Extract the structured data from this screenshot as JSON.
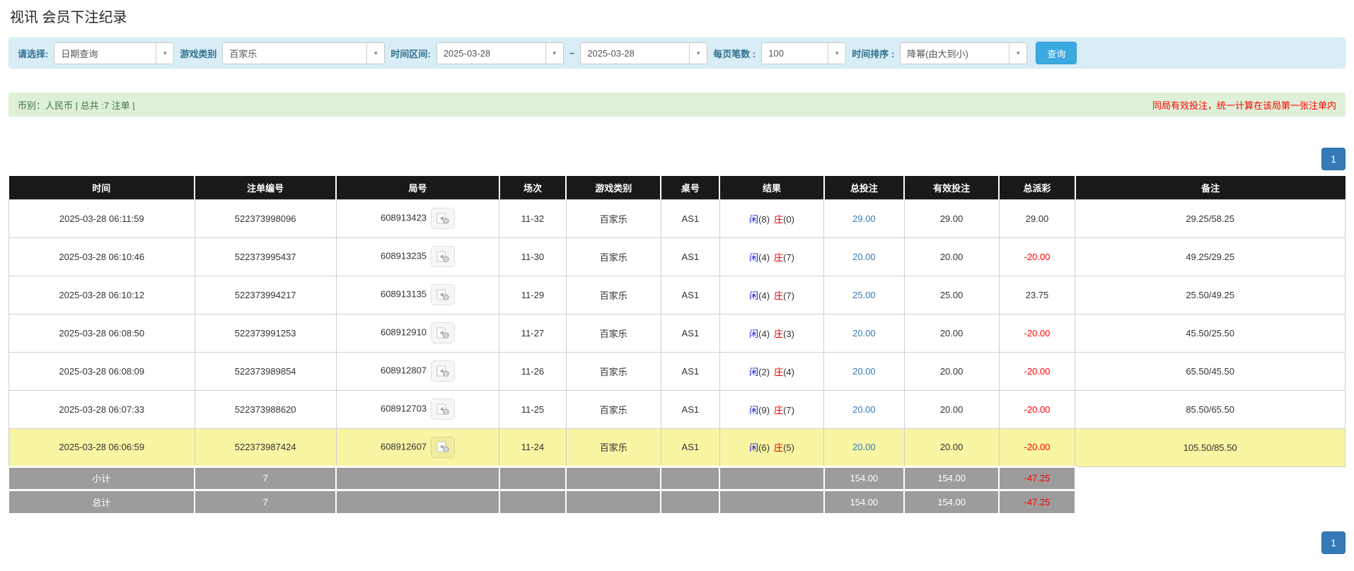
{
  "page": {
    "title": "视讯 会员下注纪录"
  },
  "filters": {
    "query_type": {
      "label": "请选择:",
      "value": "日期查询"
    },
    "game_category": {
      "label": "游戏类别",
      "value": "百家乐"
    },
    "time_range": {
      "label": "时间区间:",
      "from": "2025-03-28",
      "separator": "~",
      "to": "2025-03-28"
    },
    "page_size": {
      "label": "每页笔数 :",
      "value": "100"
    },
    "time_sort": {
      "label": "时间排序 :",
      "value": "降幂(由大到小)"
    },
    "search_button": "查询"
  },
  "summary": {
    "left": "币别：人民币 | 总共 :7 注单 |",
    "right": "同局有效投注，统一计算在该局第一张注单内"
  },
  "pagination": {
    "page": "1"
  },
  "table": {
    "headers": [
      "时间",
      "注单编号",
      "局号",
      "场次",
      "游戏类别",
      "桌号",
      "结果",
      "总投注",
      "有效投注",
      "总派彩",
      "备注"
    ],
    "rows": [
      {
        "time": "2025-03-28 06:11:59",
        "bet_id": "522373998096",
        "round_id": "608913423",
        "session": "11-32",
        "game": "百家乐",
        "table_no": "AS1",
        "result": {
          "player": "闲",
          "player_n": "(8)",
          "banker": "庄",
          "banker_n": "(0)"
        },
        "total_bet": "29.00",
        "valid_bet": "29.00",
        "payout": "29.00",
        "note": "29.25/58.25",
        "highlighted": false
      },
      {
        "time": "2025-03-28 06:10:46",
        "bet_id": "522373995437",
        "round_id": "608913235",
        "session": "11-30",
        "game": "百家乐",
        "table_no": "AS1",
        "result": {
          "player": "闲",
          "player_n": "(4)",
          "banker": "庄",
          "banker_n": "(7)"
        },
        "total_bet": "20.00",
        "valid_bet": "20.00",
        "payout": "-20.00",
        "note": "49.25/29.25",
        "highlighted": false
      },
      {
        "time": "2025-03-28 06:10:12",
        "bet_id": "522373994217",
        "round_id": "608913135",
        "session": "11-29",
        "game": "百家乐",
        "table_no": "AS1",
        "result": {
          "player": "闲",
          "player_n": "(4)",
          "banker": "庄",
          "banker_n": "(7)"
        },
        "total_bet": "25.00",
        "valid_bet": "25.00",
        "payout": "23.75",
        "note": "25.50/49.25",
        "highlighted": false
      },
      {
        "time": "2025-03-28 06:08:50",
        "bet_id": "522373991253",
        "round_id": "608912910",
        "session": "11-27",
        "game": "百家乐",
        "table_no": "AS1",
        "result": {
          "player": "闲",
          "player_n": "(4)",
          "banker": "庄",
          "banker_n": "(3)"
        },
        "total_bet": "20.00",
        "valid_bet": "20.00",
        "payout": "-20.00",
        "note": "45.50/25.50",
        "highlighted": false
      },
      {
        "time": "2025-03-28 06:08:09",
        "bet_id": "522373989854",
        "round_id": "608912807",
        "session": "11-26",
        "game": "百家乐",
        "table_no": "AS1",
        "result": {
          "player": "闲",
          "player_n": "(2)",
          "banker": "庄",
          "banker_n": "(4)"
        },
        "total_bet": "20.00",
        "valid_bet": "20.00",
        "payout": "-20.00",
        "note": "65.50/45.50",
        "highlighted": false
      },
      {
        "time": "2025-03-28 06:07:33",
        "bet_id": "522373988620",
        "round_id": "608912703",
        "session": "11-25",
        "game": "百家乐",
        "table_no": "AS1",
        "result": {
          "player": "闲",
          "player_n": "(9)",
          "banker": "庄",
          "banker_n": "(7)"
        },
        "total_bet": "20.00",
        "valid_bet": "20.00",
        "payout": "-20.00",
        "note": "85.50/65.50",
        "highlighted": false
      },
      {
        "time": "2025-03-28 06:06:59",
        "bet_id": "522373987424",
        "round_id": "608912607",
        "session": "11-24",
        "game": "百家乐",
        "table_no": "AS1",
        "result": {
          "player": "闲",
          "player_n": "(6)",
          "banker": "庄",
          "banker_n": "(5)"
        },
        "total_bet": "20.00",
        "valid_bet": "20.00",
        "payout": "-20.00",
        "note": "105.50/85.50",
        "highlighted": true
      }
    ],
    "subtotal": {
      "label": "小计",
      "count": "7",
      "total_bet": "154.00",
      "valid_bet": "154.00",
      "payout": "-47.25"
    },
    "total": {
      "label": "总计",
      "count": "7",
      "total_bet": "154.00",
      "valid_bet": "154.00",
      "payout": "-47.25"
    }
  },
  "colors": {
    "accent_blue": "#337ab7",
    "search_button_blue": "#3ca9e0",
    "filter_bar_bg": "#d9edf7",
    "summary_bar_bg": "#dff0d8",
    "summary_text_green": "#3c763d",
    "alert_red": "#ff0000",
    "table_header_bg": "#191919",
    "row_highlight_yellow": "#f8f5a3",
    "summary_row_gray": "#9c9c9c",
    "player_blue": "#1a1ae6",
    "banker_red": "#e60000"
  }
}
